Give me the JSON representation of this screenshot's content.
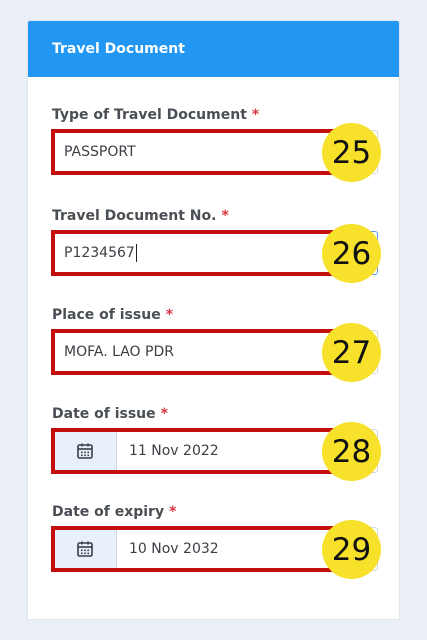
{
  "section": {
    "title": "Travel Document"
  },
  "fields": [
    {
      "label": "Type of Travel Document",
      "required": "*",
      "value": "PASSPORT",
      "badge": "25"
    },
    {
      "label": "Travel Document No.",
      "required": "*",
      "value": "P1234567",
      "badge": "26"
    },
    {
      "label": "Place of issue",
      "required": "*",
      "value": "MOFA. LAO PDR",
      "badge": "27"
    },
    {
      "label": "Date of issue",
      "required": "*",
      "value": "11 Nov 2022",
      "badge": "28"
    },
    {
      "label": "Date of expiry",
      "required": "*",
      "value": "10 Nov 2032",
      "badge": "29"
    }
  ],
  "icons": {
    "date_picker": "calendar-icon"
  },
  "colors": {
    "header": "#2196f3",
    "required_marker": "#d9363e",
    "highlight": "#c40d0d",
    "badge": "#f7e12a"
  }
}
